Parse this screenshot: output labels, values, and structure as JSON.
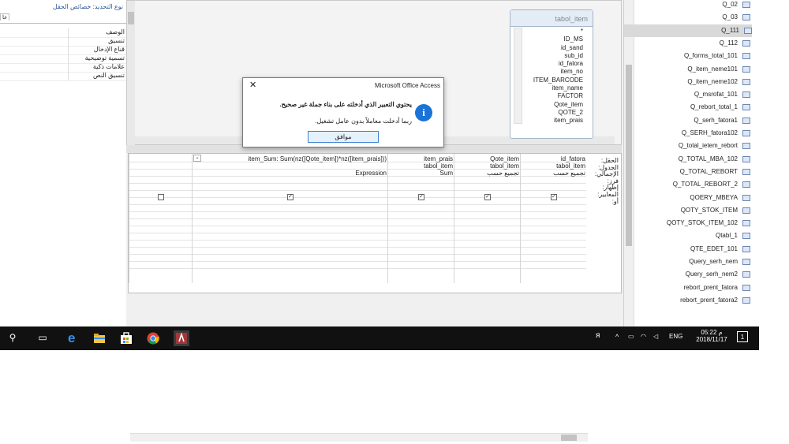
{
  "property_sheet": {
    "selection_type": "نوع التحديد:  خصائص الحقل",
    "tab_label": "عا",
    "rows": [
      "الوصف",
      "تنسيق",
      "قناع الإدخال",
      "تسمية توضيحية",
      "علامات ذكية",
      "تنسيق النص"
    ]
  },
  "table_box": {
    "name": "tabol_item",
    "fields": [
      "*",
      "ID_MS",
      "id_sand",
      "sub_id",
      "id_fatora",
      "item_no",
      "ITEM_BARCODE",
      "item_name",
      "FACTOR",
      "Qote_item",
      "QOTE_2",
      "item_prais"
    ]
  },
  "design_grid": {
    "row_labels": [
      "الحقل:",
      "الجدول:",
      "الإجمالي:",
      "فرز:",
      "إظهار:",
      "المعايير:",
      "أو:"
    ],
    "columns": [
      {
        "field": "id_fatora",
        "table": "tabol_item",
        "total": "تجميع حسب",
        "show": true
      },
      {
        "field": "Qote_item",
        "table": "tabol_item",
        "total": "تجميع حسب",
        "show": true
      },
      {
        "field": "item_prais",
        "table": "tabol_item",
        "total": "Sum",
        "show": true
      },
      {
        "field": "item_Sum: Sum(nz([Qote_item])*nz([item_prais]))",
        "table": "",
        "total": "Expression",
        "show": true
      },
      {
        "field": "",
        "table": "",
        "total": "",
        "show": false
      }
    ]
  },
  "dialog": {
    "title": "Microsoft Office Access",
    "close": "✕",
    "message": "يحتوي التعبير الذي أدخلته على بناء جملة غير صحيح.",
    "sub_message": "ربما أدخلت معاملاً بدون عامل تشغيل.",
    "ok_label": "موافق",
    "info_glyph": "i"
  },
  "nav_pane": {
    "items": [
      "Q_02",
      "Q_03",
      "Q_111",
      "Q_112",
      "Q_forms_total_101",
      "Q_item_neme101",
      "Q_item_neme102",
      "Q_msrofat_101",
      "Q_rebort_total_1",
      "Q_serh_fatora1",
      "Q_SERH_fatora102",
      "Q_total_ietem_rebort",
      "Q_TOTAL_MBA_102",
      "Q_TOTAL_REBORT",
      "Q_TOTAL_REBORT_2",
      "QOERY_MBEYA",
      "QOTY_STOK_ITEM",
      "QOTY_STOK_ITEM_102",
      "Qtabl_1",
      "QTE_EDET_101",
      "Query_serh_nem",
      "Query_serh_nem2",
      "rebort_prent_fatora",
      "rebort_prent_fatora2"
    ],
    "selected_index": 2
  },
  "taskbar": {
    "search_glyph": "⚲",
    "taskview_glyph": "▭",
    "language": "ENG",
    "time": "05:22 م",
    "date": "2018/11/17",
    "notif_count": "1"
  }
}
